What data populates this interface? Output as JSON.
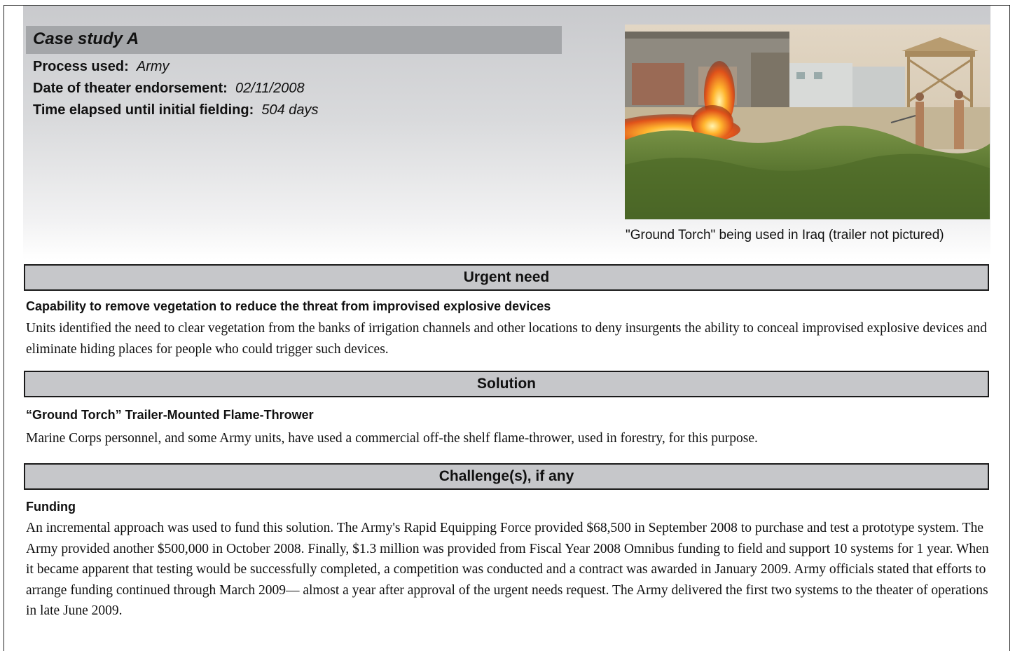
{
  "case_study": {
    "title": "Case study A",
    "process_label": "Process used:",
    "process_value": "Army",
    "endorsement_label": "Date of theater endorsement:",
    "endorsement_value": "02/11/2008",
    "elapsed_label": "Time elapsed until initial fielding:",
    "elapsed_value": "504 days"
  },
  "photo": {
    "caption": "\"Ground Torch\" being used in Iraq (trailer not pictured)"
  },
  "sections": {
    "urgent_need": {
      "heading": "Urgent need",
      "subheading": "Capability to remove vegetation to reduce the threat from improvised explosive devices",
      "body": "Units identified the need to clear vegetation from the banks of irrigation channels and other locations to deny insurgents the ability to conceal improvised explosive devices and eliminate hiding places for people who could trigger such devices."
    },
    "solution": {
      "heading": "Solution",
      "subheading": "“Ground Torch” Trailer-Mounted Flame-Thrower",
      "body": "Marine Corps personnel, and some Army units, have used a commercial off-the shelf flame-thrower, used in forestry, for this purpose."
    },
    "challenges": {
      "heading": "Challenge(s), if any",
      "subheading": "Funding",
      "body": "An incremental approach was used to fund this solution. The Army's Rapid Equipping Force provided $68,500 in September 2008 to purchase and test a prototype system. The Army provided another $500,000 in October 2008. Finally, $1.3 million was provided from Fiscal Year 2008 Omnibus funding to field and support 10 systems for 1 year. When it became apparent that testing would be successfully completed, a competition was conducted and a contract was awarded in January 2009. Army officials stated that efforts to arrange funding continued through March 2009— almost a year after approval of the urgent needs request.  The Army delivered the first two systems to the theater of operations in late June 2009."
    }
  }
}
